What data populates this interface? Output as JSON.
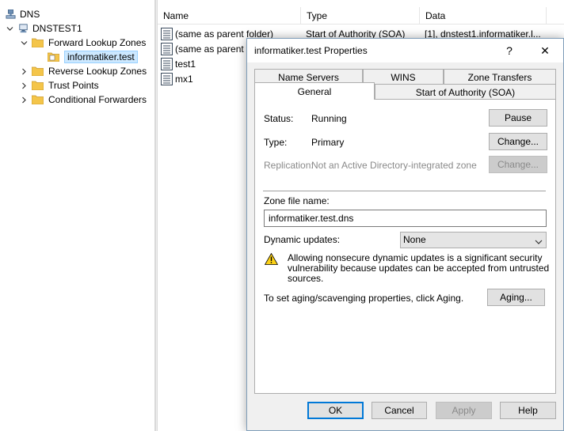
{
  "tree": {
    "root": "DNS",
    "server": "DNSTEST1",
    "forward_zones": "Forward Lookup Zones",
    "selected_zone": "informatiker.test",
    "reverse_zones": "Reverse Lookup Zones",
    "trust_points": "Trust Points",
    "conditional_forwarders": "Conditional Forwarders"
  },
  "list": {
    "columns": [
      "Name",
      "Type",
      "Data"
    ],
    "rows": [
      {
        "name": "(same as parent folder)",
        "type": "Start of Authority (SOA)",
        "data": "[1], dnstest1.informatiker.l..."
      },
      {
        "name": "(same as parent f",
        "type": "",
        "data": ""
      },
      {
        "name": "test1",
        "type": "",
        "data": ""
      },
      {
        "name": "mx1",
        "type": "",
        "data": ""
      }
    ]
  },
  "dialog": {
    "title": "informatiker.test Properties",
    "help_glyph": "?",
    "close_glyph": "✕",
    "tabs": {
      "name_servers": "Name Servers",
      "wins": "WINS",
      "zone_transfers": "Zone Transfers",
      "general": "General",
      "soa": "Start of Authority (SOA)"
    },
    "general": {
      "status_label": "Status:",
      "status_value": "Running",
      "pause_button": "Pause",
      "type_label": "Type:",
      "type_value": "Primary",
      "change_type_button": "Change...",
      "replication_label": "Replication:",
      "replication_value": "Not an Active Directory-integrated zone",
      "change_replication_button": "Change...",
      "zone_file_label": "Zone file name:",
      "zone_file_value": "informatiker.test.dns",
      "dynamic_updates_label": "Dynamic updates:",
      "dynamic_updates_value": "None",
      "warning_line1": "Allowing nonsecure dynamic updates is a significant security",
      "warning_line2": "vulnerability because updates can be accepted from untrusted",
      "warning_line3": "sources.",
      "aging_text": "To set aging/scavenging properties, click Aging.",
      "aging_button": "Aging..."
    },
    "buttons": {
      "ok": "OK",
      "cancel": "Cancel",
      "apply": "Apply",
      "help": "Help"
    }
  },
  "colors": {
    "selection": "#cce8ff",
    "dialog_bg": "#f0f0f0",
    "focus_border": "#0078d7",
    "folder_yellow": "#f4c54a"
  }
}
